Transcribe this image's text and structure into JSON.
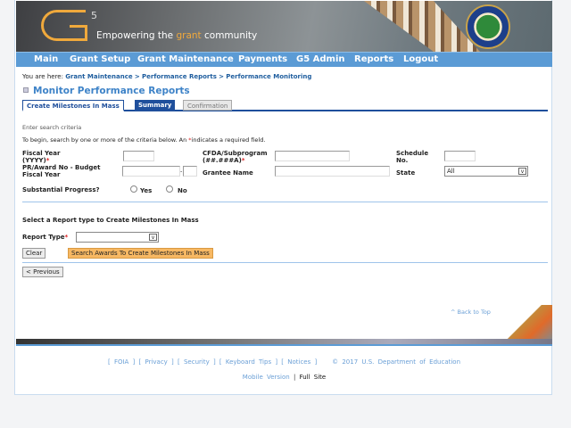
{
  "banner": {
    "logo": "G5",
    "tagline_pre": "Empowering the ",
    "tagline_accent": "grant",
    "tagline_post": " community",
    "seal": "Department of Education seal"
  },
  "nav": [
    "Main",
    "Grant Setup",
    "Grant Maintenance",
    "Payments",
    "G5 Admin",
    "Reports",
    "Logout"
  ],
  "breadcrumb": {
    "prefix": "You are here:",
    "items": [
      "Grant Maintenance",
      "Performance Reports",
      "Performance Monitoring"
    ],
    "sep": ">"
  },
  "page_title": "Monitor Performance Reports",
  "tabs": [
    {
      "label": "Create Milestones In Mass",
      "state": "active"
    },
    {
      "label": "Summary",
      "state": "enabled"
    },
    {
      "label": "Confirmation",
      "state": "disabled"
    }
  ],
  "form": {
    "intro": "Enter search criteria",
    "instructions_pre": "To begin, search by one or more of the criteria below.   An ",
    "instructions_post": "indicates a required field.",
    "fiscal_year_l1": "Fiscal Year",
    "fiscal_year_l2": "(YYYY)",
    "cfda_l1": "CFDA/Subprogram",
    "cfda_l2": "(##.###A)",
    "schedule_l1": "Schedule",
    "schedule_l2": "No.",
    "award_l1": "PR/Award No - Budget",
    "award_l2": "Fiscal Year",
    "award_sep": "-",
    "grantee": "Grantee Name",
    "state": "State",
    "state_value": "All",
    "progress": "Substantial Progress?",
    "yes": "Yes",
    "no": "No",
    "section2": "Select a Report type to Create Milestones In Mass",
    "report_type": "Report Type",
    "report_value": "",
    "clear": "Clear",
    "search": "Search Awards To Create Milestones In Mass",
    "previous": "< Previous"
  },
  "back_to_top": "^ Back to Top",
  "footer": {
    "links": [
      "FOIA",
      "Privacy",
      "Security",
      "Keyboard Tips",
      "Notices"
    ],
    "copyright": "© 2017 U.S. Department of Education",
    "mobile": "Mobile Version",
    "sep": "|",
    "full": "Full Site"
  },
  "colors": {
    "nav": "#5b9bd5",
    "accent": "#f0a93c",
    "tab_active": "#1f4f9c",
    "search_button": "#f7b863"
  }
}
